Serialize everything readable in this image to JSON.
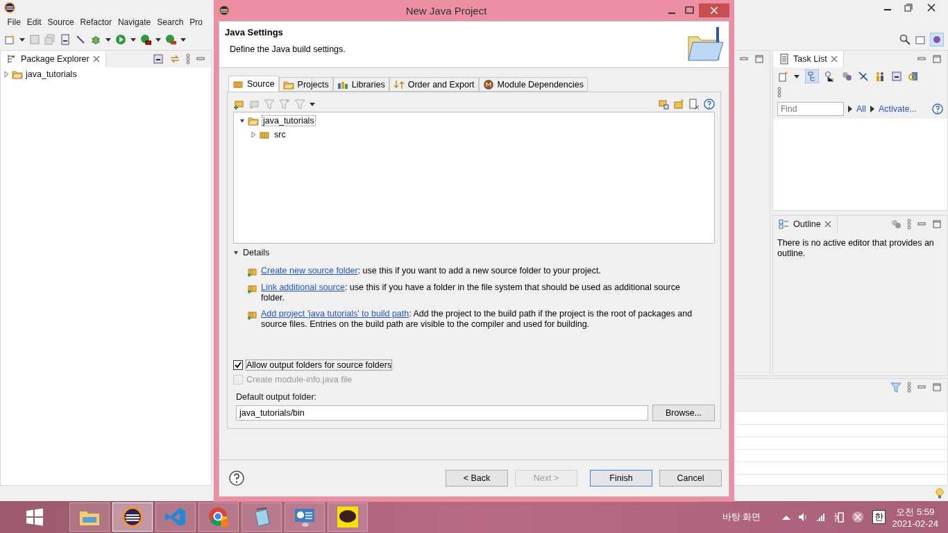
{
  "ide": {
    "menu": [
      "File",
      "Edit",
      "Source",
      "Refactor",
      "Navigate",
      "Search",
      "Pro"
    ],
    "package_explorer": {
      "title": "Package Explorer",
      "items": [
        {
          "label": "java_tutorials",
          "expanded": false
        }
      ]
    },
    "task_list": {
      "title": "Task List",
      "find_placeholder": "Find",
      "links": [
        "All",
        "Activate..."
      ]
    },
    "outline": {
      "title": "Outline",
      "message": "There is no active editor that provides an outline."
    }
  },
  "dialog": {
    "title": "New Java Project",
    "heading": "Java Settings",
    "description": "Define the Java build settings.",
    "tabs": [
      {
        "label": "Source",
        "kind": "source",
        "selected": true
      },
      {
        "label": "Projects",
        "kind": "projects",
        "selected": false
      },
      {
        "label": "Libraries",
        "kind": "libraries",
        "selected": false
      },
      {
        "label": "Order and Export",
        "kind": "order",
        "selected": false
      },
      {
        "label": "Module Dependencies",
        "kind": "module",
        "selected": false
      }
    ],
    "tree": [
      {
        "label": "java_tutorials",
        "kind": "project",
        "expanded": true,
        "children": [
          {
            "label": "src",
            "kind": "package",
            "expanded": false
          }
        ]
      }
    ],
    "details": {
      "label": "Details",
      "expanded": true,
      "entries": [
        {
          "link": "Create new source folder",
          "text": ": use this if you want to add a new source folder to your project."
        },
        {
          "link": "Link additional source",
          "text": ": use this if you have a folder in the file system that should be used as additional source folder."
        },
        {
          "link": "Add project 'java tutorials' to build path",
          "text": ": Add the project to the build path if the project is the root of packages and source files. Entries on the build path are visible to the compiler and used for building."
        }
      ]
    },
    "options": [
      {
        "label": "Allow output folders for source folders",
        "checked": true,
        "disabled": false
      },
      {
        "label": "Create module-info.java file",
        "checked": false,
        "disabled": true
      }
    ],
    "output_folder": {
      "label": "Default output folder:",
      "value": "java_tutorials/bin",
      "browse": "Browse..."
    },
    "buttons": [
      {
        "label": "< Back",
        "disabled": false,
        "default": false
      },
      {
        "label": "Next >",
        "disabled": true,
        "default": false
      },
      {
        "label": "Finish",
        "disabled": false,
        "default": true
      },
      {
        "label": "Cancel",
        "disabled": false,
        "default": false
      }
    ]
  },
  "taskbar": {
    "apps": [
      {
        "kind": "files",
        "selected": false
      },
      {
        "kind": "eclipse",
        "selected": true
      },
      {
        "kind": "code",
        "selected": false
      },
      {
        "kind": "browser",
        "selected": false
      },
      {
        "kind": "notepad",
        "selected": false
      },
      {
        "kind": "control",
        "selected": false
      },
      {
        "kind": "talk",
        "selected": false
      }
    ],
    "desktop_label": "바탕 화면",
    "ime": "한",
    "time": "오전 5:59",
    "date": "2021-02-24"
  }
}
